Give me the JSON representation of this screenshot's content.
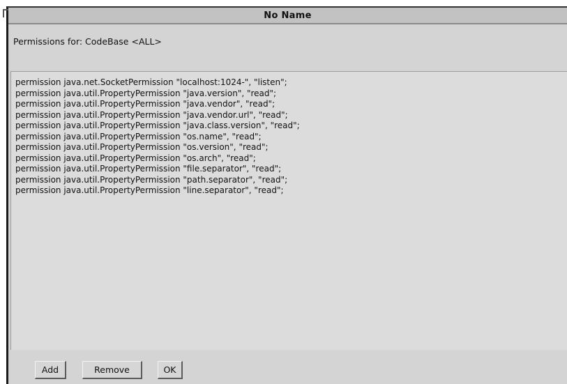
{
  "window": {
    "title": "No Name"
  },
  "header": {
    "permissions_label": "Permissions for: CodeBase <ALL>"
  },
  "permissions": [
    "permission java.net.SocketPermission \"localhost:1024-\", \"listen\";",
    "permission java.util.PropertyPermission \"java.version\", \"read\";",
    "permission java.util.PropertyPermission \"java.vendor\", \"read\";",
    "permission java.util.PropertyPermission \"java.vendor.url\", \"read\";",
    "permission java.util.PropertyPermission \"java.class.version\", \"read\";",
    "permission java.util.PropertyPermission \"os.name\", \"read\";",
    "permission java.util.PropertyPermission \"os.version\", \"read\";",
    "permission java.util.PropertyPermission \"os.arch\", \"read\";",
    "permission java.util.PropertyPermission \"file.separator\", \"read\";",
    "permission java.util.PropertyPermission \"path.separator\", \"read\";",
    "permission java.util.PropertyPermission \"line.separator\", \"read\";"
  ],
  "buttons": {
    "add_label": "Add",
    "remove_label": "Remove",
    "ok_label": "OK"
  },
  "colors": {
    "window_background": "#d4d4d4",
    "title_bar": "#c2c2c2",
    "text": "#111111"
  }
}
